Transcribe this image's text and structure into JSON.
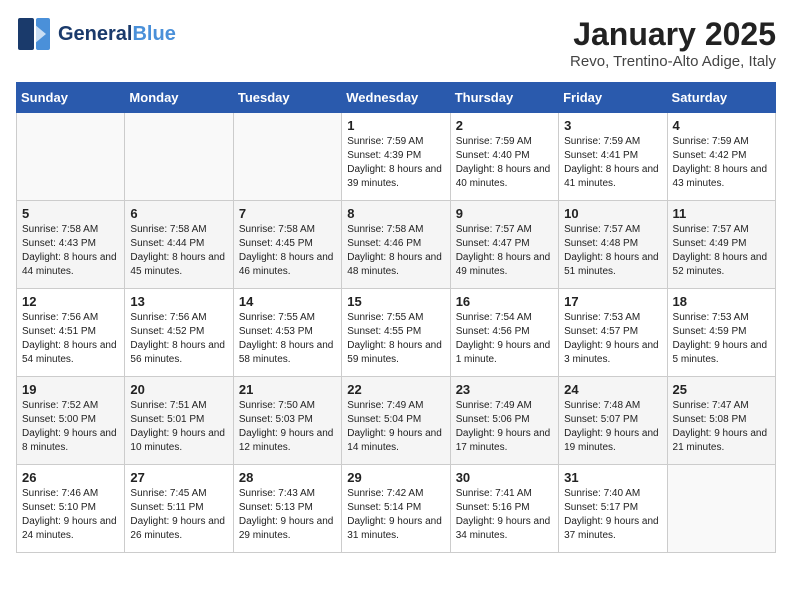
{
  "logo": {
    "line1": "General",
    "line2": "Blue"
  },
  "title": "January 2025",
  "subtitle": "Revo, Trentino-Alto Adige, Italy",
  "weekdays": [
    "Sunday",
    "Monday",
    "Tuesday",
    "Wednesday",
    "Thursday",
    "Friday",
    "Saturday"
  ],
  "weeks": [
    [
      {
        "day": "",
        "info": ""
      },
      {
        "day": "",
        "info": ""
      },
      {
        "day": "",
        "info": ""
      },
      {
        "day": "1",
        "info": "Sunrise: 7:59 AM\nSunset: 4:39 PM\nDaylight: 8 hours and 39 minutes."
      },
      {
        "day": "2",
        "info": "Sunrise: 7:59 AM\nSunset: 4:40 PM\nDaylight: 8 hours and 40 minutes."
      },
      {
        "day": "3",
        "info": "Sunrise: 7:59 AM\nSunset: 4:41 PM\nDaylight: 8 hours and 41 minutes."
      },
      {
        "day": "4",
        "info": "Sunrise: 7:59 AM\nSunset: 4:42 PM\nDaylight: 8 hours and 43 minutes."
      }
    ],
    [
      {
        "day": "5",
        "info": "Sunrise: 7:58 AM\nSunset: 4:43 PM\nDaylight: 8 hours and 44 minutes."
      },
      {
        "day": "6",
        "info": "Sunrise: 7:58 AM\nSunset: 4:44 PM\nDaylight: 8 hours and 45 minutes."
      },
      {
        "day": "7",
        "info": "Sunrise: 7:58 AM\nSunset: 4:45 PM\nDaylight: 8 hours and 46 minutes."
      },
      {
        "day": "8",
        "info": "Sunrise: 7:58 AM\nSunset: 4:46 PM\nDaylight: 8 hours and 48 minutes."
      },
      {
        "day": "9",
        "info": "Sunrise: 7:57 AM\nSunset: 4:47 PM\nDaylight: 8 hours and 49 minutes."
      },
      {
        "day": "10",
        "info": "Sunrise: 7:57 AM\nSunset: 4:48 PM\nDaylight: 8 hours and 51 minutes."
      },
      {
        "day": "11",
        "info": "Sunrise: 7:57 AM\nSunset: 4:49 PM\nDaylight: 8 hours and 52 minutes."
      }
    ],
    [
      {
        "day": "12",
        "info": "Sunrise: 7:56 AM\nSunset: 4:51 PM\nDaylight: 8 hours and 54 minutes."
      },
      {
        "day": "13",
        "info": "Sunrise: 7:56 AM\nSunset: 4:52 PM\nDaylight: 8 hours and 56 minutes."
      },
      {
        "day": "14",
        "info": "Sunrise: 7:55 AM\nSunset: 4:53 PM\nDaylight: 8 hours and 58 minutes."
      },
      {
        "day": "15",
        "info": "Sunrise: 7:55 AM\nSunset: 4:55 PM\nDaylight: 8 hours and 59 minutes."
      },
      {
        "day": "16",
        "info": "Sunrise: 7:54 AM\nSunset: 4:56 PM\nDaylight: 9 hours and 1 minute."
      },
      {
        "day": "17",
        "info": "Sunrise: 7:53 AM\nSunset: 4:57 PM\nDaylight: 9 hours and 3 minutes."
      },
      {
        "day": "18",
        "info": "Sunrise: 7:53 AM\nSunset: 4:59 PM\nDaylight: 9 hours and 5 minutes."
      }
    ],
    [
      {
        "day": "19",
        "info": "Sunrise: 7:52 AM\nSunset: 5:00 PM\nDaylight: 9 hours and 8 minutes."
      },
      {
        "day": "20",
        "info": "Sunrise: 7:51 AM\nSunset: 5:01 PM\nDaylight: 9 hours and 10 minutes."
      },
      {
        "day": "21",
        "info": "Sunrise: 7:50 AM\nSunset: 5:03 PM\nDaylight: 9 hours and 12 minutes."
      },
      {
        "day": "22",
        "info": "Sunrise: 7:49 AM\nSunset: 5:04 PM\nDaylight: 9 hours and 14 minutes."
      },
      {
        "day": "23",
        "info": "Sunrise: 7:49 AM\nSunset: 5:06 PM\nDaylight: 9 hours and 17 minutes."
      },
      {
        "day": "24",
        "info": "Sunrise: 7:48 AM\nSunset: 5:07 PM\nDaylight: 9 hours and 19 minutes."
      },
      {
        "day": "25",
        "info": "Sunrise: 7:47 AM\nSunset: 5:08 PM\nDaylight: 9 hours and 21 minutes."
      }
    ],
    [
      {
        "day": "26",
        "info": "Sunrise: 7:46 AM\nSunset: 5:10 PM\nDaylight: 9 hours and 24 minutes."
      },
      {
        "day": "27",
        "info": "Sunrise: 7:45 AM\nSunset: 5:11 PM\nDaylight: 9 hours and 26 minutes."
      },
      {
        "day": "28",
        "info": "Sunrise: 7:43 AM\nSunset: 5:13 PM\nDaylight: 9 hours and 29 minutes."
      },
      {
        "day": "29",
        "info": "Sunrise: 7:42 AM\nSunset: 5:14 PM\nDaylight: 9 hours and 31 minutes."
      },
      {
        "day": "30",
        "info": "Sunrise: 7:41 AM\nSunset: 5:16 PM\nDaylight: 9 hours and 34 minutes."
      },
      {
        "day": "31",
        "info": "Sunrise: 7:40 AM\nSunset: 5:17 PM\nDaylight: 9 hours and 37 minutes."
      },
      {
        "day": "",
        "info": ""
      }
    ]
  ]
}
